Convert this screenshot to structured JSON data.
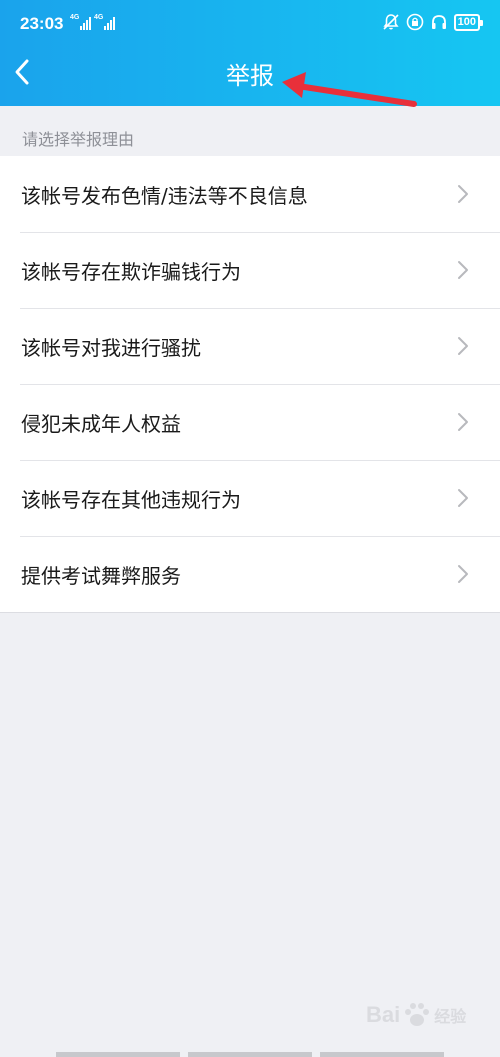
{
  "status_bar": {
    "time": "23:03",
    "signal_1_label": "4G",
    "signal_2_label": "4G",
    "battery": "100"
  },
  "header": {
    "title": "举报"
  },
  "section_header": "请选择举报理由",
  "report_reasons": [
    {
      "label": "该帐号发布色情/违法等不良信息"
    },
    {
      "label": "该帐号存在欺诈骗钱行为"
    },
    {
      "label": "该帐号对我进行骚扰"
    },
    {
      "label": "侵犯未成年人权益"
    },
    {
      "label": "该帐号存在其他违规行为"
    },
    {
      "label": "提供考试舞弊服务"
    }
  ],
  "watermark": {
    "brand": "Bai",
    "sub": "经验"
  },
  "colors": {
    "header_gradient_start": "#1aa3ec",
    "header_gradient_end": "#16c6f2",
    "annotation_arrow": "#e8303a",
    "background": "#eff0f4"
  }
}
